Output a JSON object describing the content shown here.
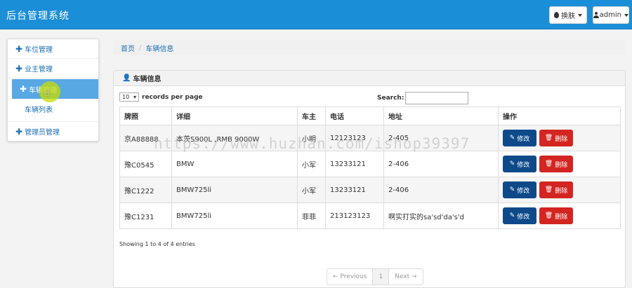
{
  "header": {
    "title": "后台管理系统",
    "skin_label": "换肤",
    "user_label": "admin"
  },
  "sidebar": {
    "items": [
      {
        "label": "车位管理"
      },
      {
        "label": "业主管理"
      },
      {
        "label": "车辆管理"
      },
      {
        "label": "管理员管理"
      }
    ],
    "sub_item": "车辆列表"
  },
  "breadcrumb": {
    "home": "首页",
    "sep": "/",
    "current": "车辆信息"
  },
  "panel": {
    "title": "车辆信息"
  },
  "table_controls": {
    "length_value": "10",
    "length_suffix": "records per page",
    "search_label": "Search:"
  },
  "table": {
    "columns": [
      "牌照",
      "详细",
      "车主",
      "电话",
      "地址",
      "操作"
    ],
    "rows": [
      {
        "plate": "京A88888",
        "detail": "本茨S900L ,RMB 9000W",
        "owner": "小明",
        "phone": "12123123",
        "address": "2-405"
      },
      {
        "plate": "豫C0545",
        "detail": "BMW",
        "owner": "小军",
        "phone": "13233121",
        "address": "2-406"
      },
      {
        "plate": "豫C1222",
        "detail": "BMW725li",
        "owner": "小军",
        "phone": "13233121",
        "address": "2-406"
      },
      {
        "plate": "豫C1231",
        "detail": "BMW725li",
        "owner": "菲菲",
        "phone": "213123123",
        "address": "啊实打实的sa'sd'da's'd"
      }
    ],
    "edit_label": "修改",
    "delete_label": "删除"
  },
  "info_text": "Showing 1 to 4 of 4 entries",
  "pager": {
    "prev": "← Previous",
    "page": "1",
    "next": "Next →"
  },
  "watermark": "https://www.huzhan.com/ishop39397",
  "colors": {
    "topbar": "#1b8ed8",
    "edit": "#0e4a8a",
    "delete": "#d32521",
    "active": "#58a8e4"
  }
}
